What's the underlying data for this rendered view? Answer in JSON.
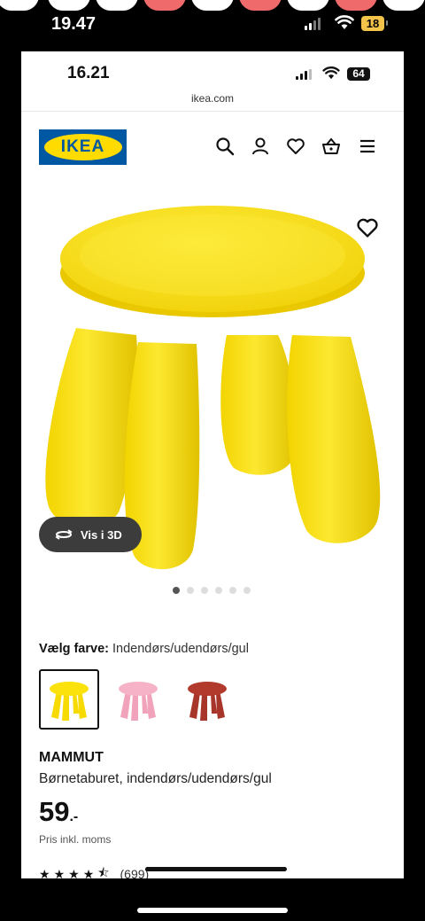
{
  "outer_status": {
    "time": "19.47",
    "battery": "18"
  },
  "inner_status": {
    "time": "16.21",
    "battery": "64"
  },
  "browser": {
    "url": "ikea.com"
  },
  "header": {
    "logo_text": "IKEA",
    "icons": [
      "search-icon",
      "account-icon",
      "favorites-icon",
      "basket-icon",
      "menu-icon"
    ]
  },
  "product_image": {
    "view_3d_label": "Vis i 3D",
    "carousel_count": 6,
    "carousel_active": 0,
    "stool_color": "#fbe20c"
  },
  "color_picker": {
    "label": "Vælg farve:",
    "value": "Indendørs/udendørs/gul",
    "options": [
      {
        "color": "#fbe20c",
        "selected": true
      },
      {
        "color": "#f6b3c8",
        "selected": false
      },
      {
        "color": "#b23a2d",
        "selected": false
      }
    ]
  },
  "product": {
    "name": "MAMMUT",
    "description": "Børnetaburet, indendørs/udendørs/gul",
    "price_main": "59",
    "price_suffix": ".-",
    "price_note": "Pris inkl. moms",
    "rating_stars": 4.5,
    "rating_count": "(699)"
  }
}
